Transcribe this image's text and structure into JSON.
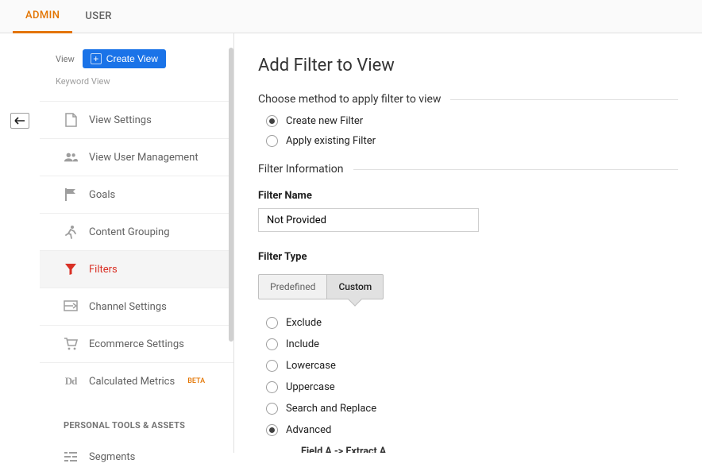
{
  "tabs": {
    "admin": "ADMIN",
    "user": "USER"
  },
  "sidebar": {
    "view_label": "View",
    "create_view_button": "Create View",
    "view_name": "Keyword View",
    "nav": {
      "view_settings": "View Settings",
      "view_user_management": "View User Management",
      "goals": "Goals",
      "content_grouping": "Content Grouping",
      "filters": "Filters",
      "channel_settings": "Channel Settings",
      "ecommerce_settings": "Ecommerce Settings",
      "calculated_metrics": "Calculated Metrics",
      "calculated_metrics_badge": "BETA",
      "segments": "Segments"
    },
    "section_personal": "PERSONAL TOOLS & ASSETS"
  },
  "main": {
    "title": "Add Filter to View",
    "choose_method_label": "Choose method to apply filter to view",
    "method_create": "Create new Filter",
    "method_apply_existing": "Apply existing Filter",
    "filter_info_label": "Filter Information",
    "filter_name_label": "Filter Name",
    "filter_name_value": "Not Provided",
    "filter_type_label": "Filter Type",
    "filter_type_predefined": "Predefined",
    "filter_type_custom": "Custom",
    "custom": {
      "exclude": "Exclude",
      "include": "Include",
      "lowercase": "Lowercase",
      "uppercase": "Uppercase",
      "search_replace": "Search and Replace",
      "advanced": "Advanced",
      "field_a_label": "Field A -> Extract A"
    }
  }
}
